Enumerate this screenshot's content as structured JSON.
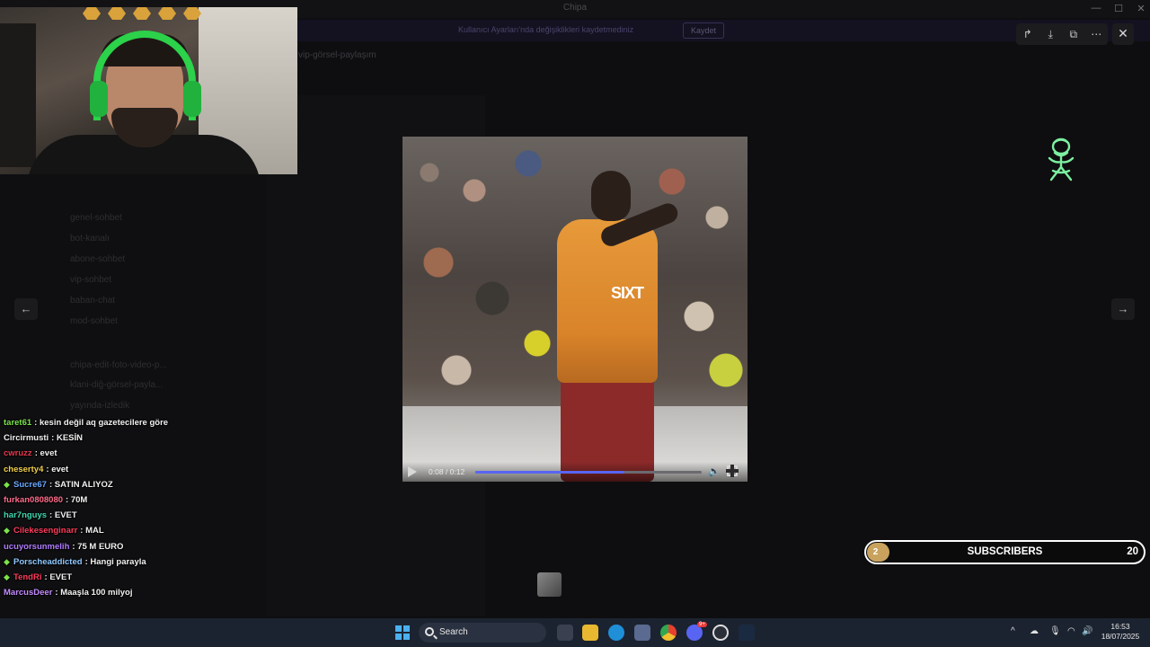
{
  "window": {
    "title": "Chipa",
    "minimize": "—",
    "maximize": "☐",
    "close": "✕"
  },
  "banner": {
    "text": "Kullanıcı Ayarları'nda değişiklikleri kaydetmediniz",
    "button": "Kaydet"
  },
  "channel_header": "vip-görsel-paylaşım",
  "sidebar": {
    "items": [
      "genel-sohbet",
      "bot-kanalı",
      "abone-sohbet",
      "vip-sohbet",
      "baban-chat",
      "mod-sohbet",
      "chipa-edit-foto-video-p...",
      "klani-diğ-görsel-payla...",
      "yayında-izledik"
    ]
  },
  "viewer": {
    "toolbar": {
      "forward_icon": "↱",
      "download_icon": "⤓",
      "open_icon": "⧉",
      "more_icon": "⋯"
    },
    "close_icon": "✕",
    "prev_icon": "←",
    "next_icon": "→",
    "video": {
      "sponsor_text": "SIXT",
      "time_current": "0:08",
      "time_total": "0:12",
      "progress": 0.66
    }
  },
  "chat": [
    {
      "user": "taret61",
      "color": "#7be34a",
      "message": "kesin değil aq gazetecilere göre",
      "badge": false
    },
    {
      "user": "Circirmusti",
      "color": "#f1f1f1",
      "message": "KESİN",
      "badge": false
    },
    {
      "user": "cwruzz",
      "color": "#e8384f",
      "message": "evet",
      "badge": false
    },
    {
      "user": "cheserty4",
      "color": "#f2d04c",
      "message": "evet",
      "badge": false
    },
    {
      "user": "Sucre67",
      "color": "#6aa8ff",
      "message": "SATIN ALIYOZ",
      "badge": true
    },
    {
      "user": "furkan0808080",
      "color": "#ff6b8a",
      "message": "70M",
      "badge": false
    },
    {
      "user": "har7nguys",
      "color": "#40d8b0",
      "message": "EVET",
      "badge": false
    },
    {
      "user": "Cilekesenginarr",
      "color": "#ff3b5c",
      "message": "MAL",
      "badge": true
    },
    {
      "user": "ucuyorsunmelih",
      "color": "#b07cff",
      "message": "75 M EURO",
      "badge": false
    },
    {
      "user": "Porscheaddicted",
      "color": "#8ec8ff",
      "message": "Hangi parayla",
      "badge": true
    },
    {
      "user": "TendRi",
      "color": "#ff3b5c",
      "message": "EVET",
      "badge": true
    },
    {
      "user": "MarcusDeer",
      "color": "#c48cff",
      "message": "Maaşla 100 milyoj",
      "badge": false
    }
  ],
  "subscribers": {
    "level": "2",
    "label": "SUBSCRIBERS",
    "count": "20"
  },
  "taskbar": {
    "search_placeholder": "Search",
    "time": "16:53",
    "date": "18/07/2025",
    "tray_chevron": "^",
    "notification_count": "9+"
  },
  "colors": {
    "accent": "#5865f2",
    "mascot": "#7cf0a0",
    "subs_gold": "#c9a35e"
  }
}
